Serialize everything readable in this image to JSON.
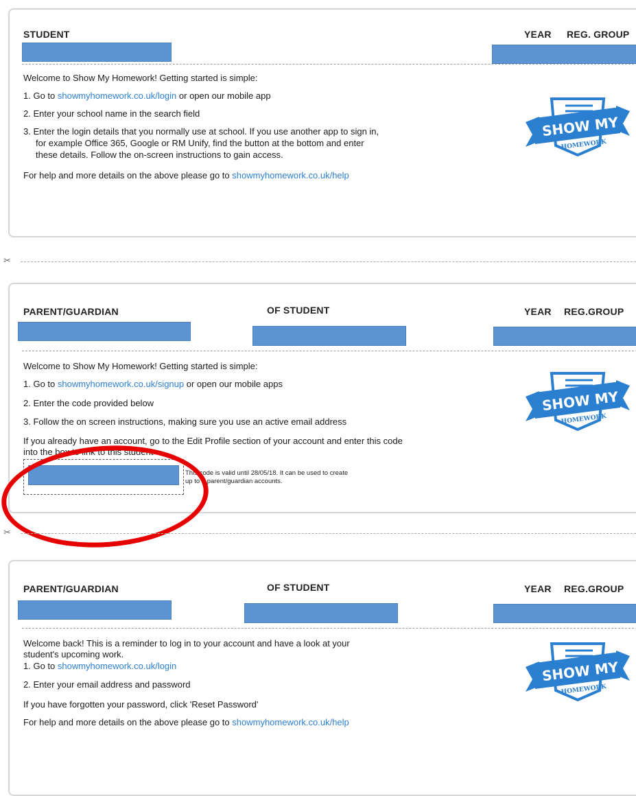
{
  "card1": {
    "student_label": "STUDENT",
    "year_label": "YEAR",
    "reg_label": "REG. GROUP",
    "intro": "Welcome to Show My Homework! Getting started is simple:",
    "step1_pre": "1. Go to ",
    "step1_link": "showmyhomework.co.uk/login",
    "step1_post": " or open our mobile app",
    "step2": "2. Enter your school name in the search field",
    "step3_line1": "3. Enter the login details that you normally use at school. If you use another app to sign in,",
    "step3_line2": "for example Office 365, Google or RM Unify, find the button at the bottom and enter",
    "step3_line3": "these details. Follow the on-screen instructions to gain access.",
    "help_pre": "For help and more details on the above please go to ",
    "help_link": "showmyhomework.co.uk/help"
  },
  "card2": {
    "parent_label": "PARENT/GUARDIAN",
    "of_student_label": "OF STUDENT",
    "year_label": "YEAR",
    "reg_label": "REG.GROUP",
    "intro": "Welcome to Show My Homework! Getting started is simple:",
    "step1_pre": "1. Go to ",
    "step1_link": "showmyhomework.co.uk/signup",
    "step1_post": " or open our mobile apps",
    "step2": "2. Enter the code provided below",
    "step3": "3. Follow the on screen instructions, making sure you use an active email address",
    "account_line1": "If you already have an account, go to the Edit Profile section of your account and enter this code",
    "account_line2": "into the box to link to this student",
    "code_note_line1": "This code is valid until 28/05/18. It can be used to create",
    "code_note_line2": "up to 5 parent/guardian accounts."
  },
  "card3": {
    "parent_label": "PARENT/GUARDIAN",
    "of_student_label": "OF STUDENT",
    "year_label": "YEAR",
    "reg_label": "REG.GROUP",
    "intro_line1": "Welcome back! This is a reminder to log in to your account and have a look at your",
    "intro_line2": "student's upcoming work.",
    "step1_pre": "1. Go to ",
    "step1_link": "showmyhomework.co.uk/login",
    "step2": "2. Enter your email address and password",
    "forgot": "If you have forgotten your password, click 'Reset Password'",
    "help_pre": "For help and more details on the above please go to ",
    "help_link": "showmyhomework.co.uk/help"
  },
  "logo": {
    "line1": "SHOW MY",
    "line2": "HOMEWORK"
  },
  "scissor_glyph": "✂",
  "colors": {
    "link": "#2d7fd3",
    "redaction": "#5b93d3",
    "logo_blue": "#2a7fd0",
    "annotation_red": "#e60000"
  }
}
